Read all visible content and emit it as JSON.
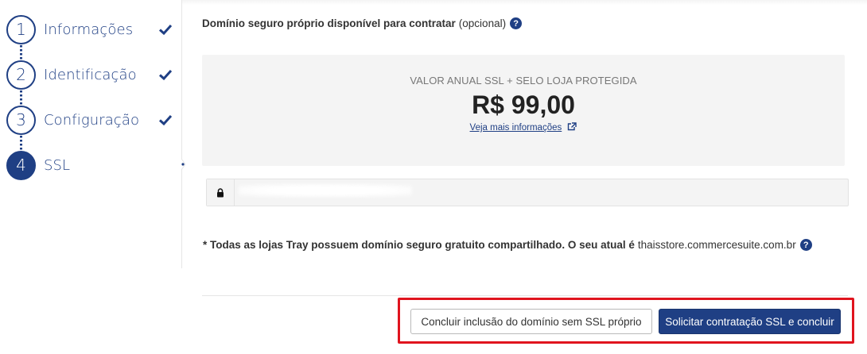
{
  "steps": [
    {
      "number": "1",
      "label": "Informações",
      "completed": true
    },
    {
      "number": "2",
      "label": "Identificação",
      "completed": true
    },
    {
      "number": "3",
      "label": "Configuração",
      "completed": true
    },
    {
      "number": "4",
      "label": "SSL",
      "completed": false,
      "active": true
    }
  ],
  "ssl": {
    "title": "Domínio seguro próprio disponível para contratar",
    "title_optional": "(opcional)",
    "help_glyph": "?",
    "price_caption": "VALOR ANUAL SSL + SELO LOJA PROTEGIDA",
    "price": "R$ 99,00",
    "more_info_link": "Veja mais informações",
    "domain_value": ""
  },
  "note": {
    "text": "* Todas as lojas Tray possuem domínio seguro gratuito compartilhado. O seu atual é",
    "site": "thaisstore.commercesuite.com.br"
  },
  "actions": {
    "secondary_label": "Concluir inclusão do domínio sem SSL próprio",
    "primary_label": "Solicitar contratação SSL e concluir"
  },
  "colors": {
    "brand": "#1f3f84",
    "highlight": "#e0141e",
    "panel": "#f4f4f4"
  }
}
